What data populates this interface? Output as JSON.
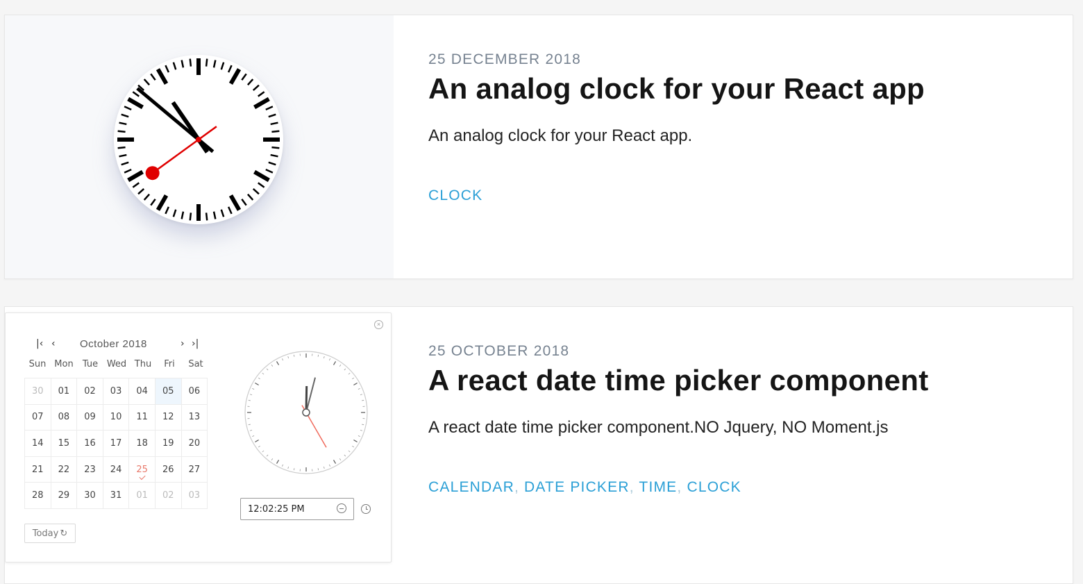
{
  "posts": [
    {
      "date": "25 DECEMBER 2018",
      "title": "An analog clock for your React app",
      "description": "An analog clock for your React app.",
      "tags": [
        "CLOCK"
      ],
      "clock": {
        "hour": 10,
        "minute": 51,
        "second": 39,
        "hand_color": "#000000",
        "second_hand_color": "#e00000"
      }
    },
    {
      "date": "25 OCTOBER 2018",
      "title": "A react date time picker component",
      "description": "A react date time picker component.NO Jquery, NO Moment.js",
      "tags": [
        "CALENDAR",
        "DATE PICKER",
        "TIME",
        "CLOCK"
      ],
      "picker": {
        "month_label": "October  2018",
        "nav": {
          "first": "|<",
          "prev": "<",
          "next": ">",
          "last": ">|"
        },
        "weekdays": [
          "Sun",
          "Mon",
          "Tue",
          "Wed",
          "Thu",
          "Fri",
          "Sat"
        ],
        "weeks": [
          [
            "30",
            "01",
            "02",
            "03",
            "04",
            "05",
            "06"
          ],
          [
            "07",
            "08",
            "09",
            "10",
            "11",
            "12",
            "13"
          ],
          [
            "14",
            "15",
            "16",
            "17",
            "18",
            "19",
            "20"
          ],
          [
            "21",
            "22",
            "23",
            "24",
            "25",
            "26",
            "27"
          ],
          [
            "28",
            "29",
            "30",
            "31",
            "01",
            "02",
            "03"
          ]
        ],
        "selected_day": "05",
        "today_day": "25",
        "today_label": "Today",
        "time_value": "12:02:25  PM",
        "clock": {
          "hour": 12,
          "minute": 2,
          "second": 25
        }
      }
    }
  ],
  "colors": {
    "tag": "#2a9fd6",
    "date": "#768290",
    "today": "#e8786a"
  }
}
